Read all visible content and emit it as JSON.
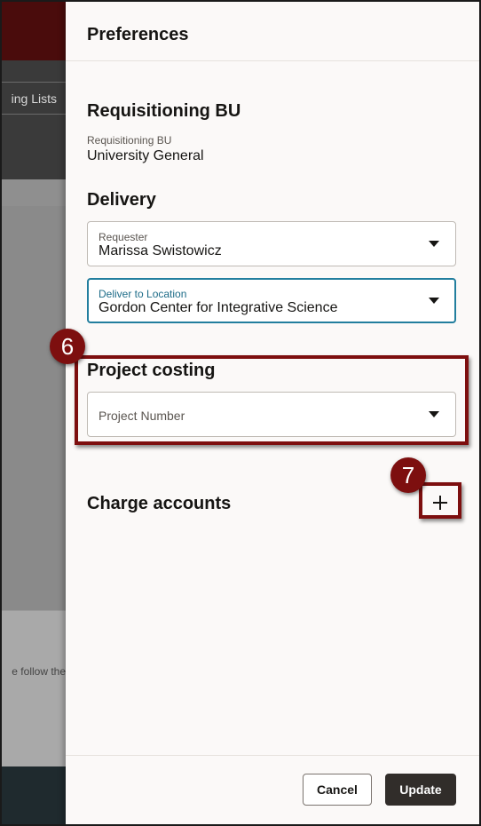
{
  "background": {
    "tab_label": "ing Lists",
    "snippet": "e follow the"
  },
  "drawer": {
    "title": "Preferences",
    "requisitioning_bu": {
      "heading": "Requisitioning BU",
      "field_label": "Requisitioning BU",
      "field_value": "University General"
    },
    "delivery": {
      "heading": "Delivery",
      "requester": {
        "label": "Requester",
        "value": "Marissa Swistowicz"
      },
      "deliver_to": {
        "label": "Deliver to Location",
        "value": "Gordon Center for Integrative Science"
      }
    },
    "project_costing": {
      "heading": "Project costing",
      "project_number": {
        "placeholder": "Project Number"
      }
    },
    "charge_accounts": {
      "heading": "Charge accounts",
      "add_icon": "plus-icon"
    },
    "footer": {
      "cancel_label": "Cancel",
      "update_label": "Update"
    }
  },
  "callouts": [
    {
      "number": "6"
    },
    {
      "number": "7"
    }
  ],
  "colors": {
    "callout": "#7d0f0f",
    "focus": "#227e9e",
    "primary_button": "#312d2a"
  }
}
